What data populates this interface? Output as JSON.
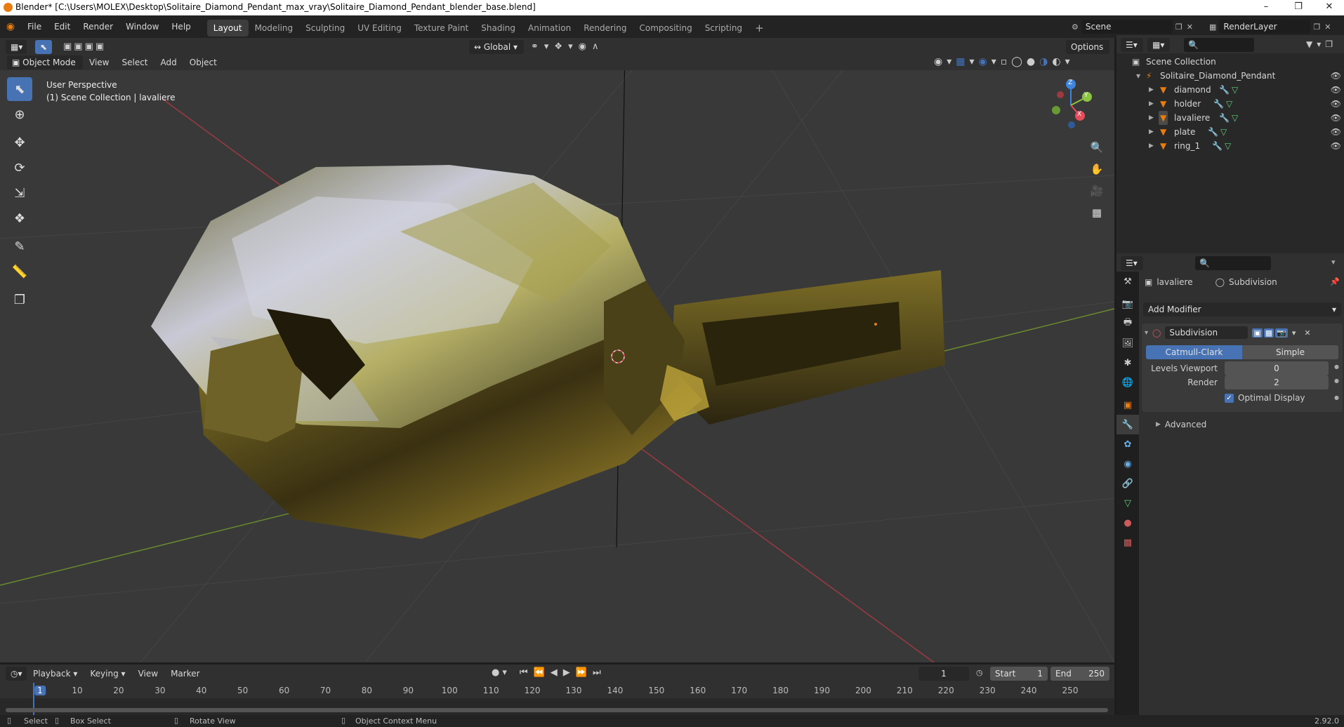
{
  "window": {
    "title": "Blender* [C:\\Users\\MOLEX\\Desktop\\Solitaire_Diamond_Pendant_max_vray\\Solitaire_Diamond_Pendant_blender_base.blend]"
  },
  "menu": [
    "File",
    "Edit",
    "Render",
    "Window",
    "Help"
  ],
  "workspaces": [
    "Layout",
    "Modeling",
    "Sculpting",
    "UV Editing",
    "Texture Paint",
    "Shading",
    "Animation",
    "Rendering",
    "Compositing",
    "Scripting"
  ],
  "scene": {
    "name": "Scene",
    "render_layer": "RenderLayer"
  },
  "viewport_header": {
    "orientation": "Global",
    "options": "Options",
    "mode": "Object Mode",
    "menus": [
      "View",
      "Select",
      "Add",
      "Object"
    ]
  },
  "viewport": {
    "perspective": "User Perspective",
    "collection_info": "(1) Scene Collection | lavaliere",
    "axes": {
      "x": "X",
      "y": "Y",
      "z": "Z"
    }
  },
  "outliner": {
    "root": "Scene Collection",
    "collection": "Solitaire_Diamond_Pendant",
    "objects": [
      "diamond",
      "holder",
      "lavaliere",
      "plate",
      "ring_1"
    ]
  },
  "properties": {
    "object_name": "lavaliere",
    "modifier_context": "Subdivision",
    "add_modifier": "Add Modifier",
    "modifier": {
      "name": "Subdivision",
      "type_options": [
        "Catmull-Clark",
        "Simple"
      ],
      "selected_type": "Catmull-Clark",
      "levels_viewport_label": "Levels Viewport",
      "levels_viewport": "0",
      "render_label": "Render",
      "render": "2",
      "optimal_display_label": "Optimal Display",
      "optimal_display": true,
      "advanced": "Advanced"
    }
  },
  "timeline": {
    "menus": [
      "Playback",
      "Keying",
      "View",
      "Marker"
    ],
    "current_frame": "1",
    "start_label": "Start",
    "start": "1",
    "end_label": "End",
    "end": "250",
    "ticks": [
      "1",
      "10",
      "20",
      "30",
      "40",
      "50",
      "60",
      "70",
      "80",
      "90",
      "100",
      "110",
      "120",
      "130",
      "140",
      "150",
      "160",
      "170",
      "180",
      "190",
      "200",
      "210",
      "220",
      "230",
      "240",
      "250"
    ]
  },
  "statusbar": {
    "select": "Select",
    "box_select": "Box Select",
    "rotate_view": "Rotate View",
    "context_menu": "Object Context Menu",
    "version": "2.92.0"
  },
  "colors": {
    "accent": "#4772b3",
    "x_axis": "#e64d5a",
    "y_axis": "#8bc53f",
    "z_axis": "#3d85e0",
    "object_orange": "#e87d0d"
  }
}
